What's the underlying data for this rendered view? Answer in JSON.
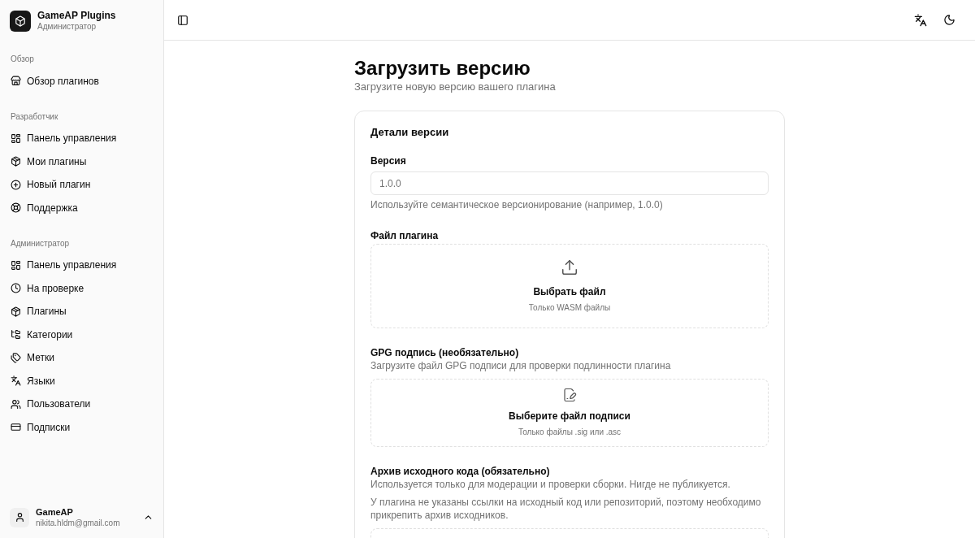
{
  "app": {
    "name": "GameAP Plugins",
    "role": "Администратор"
  },
  "sidebar": {
    "sections": [
      {
        "title": "Обзор",
        "items": [
          {
            "label": "Обзор плагинов",
            "kind": "store"
          }
        ]
      },
      {
        "title": "Разработчик",
        "items": [
          {
            "label": "Панель управления",
            "kind": "dashboard"
          },
          {
            "label": "Мои плагины",
            "kind": "package"
          },
          {
            "label": "Новый плагин",
            "kind": "add"
          },
          {
            "label": "Поддержка",
            "kind": "support"
          }
        ]
      },
      {
        "title": "Администратор",
        "items": [
          {
            "label": "Панель управления",
            "kind": "dashboard"
          },
          {
            "label": "На проверке",
            "kind": "review"
          },
          {
            "label": "Плагины",
            "kind": "package"
          },
          {
            "label": "Категории",
            "kind": "categories"
          },
          {
            "label": "Метки",
            "kind": "tags"
          },
          {
            "label": "Языки",
            "kind": "languages"
          },
          {
            "label": "Пользователи",
            "kind": "users"
          },
          {
            "label": "Подписки",
            "kind": "subscriptions"
          }
        ]
      }
    ]
  },
  "user": {
    "name": "GameAP",
    "email": "nikita.hldm@gmail.com"
  },
  "page": {
    "title": "Загрузить версию",
    "subtitle": "Загрузите новую версию вашего плагина"
  },
  "card": {
    "title": "Детали версии",
    "version_field": {
      "label": "Версия",
      "placeholder": "1.0.0",
      "hint": "Используйте семантическое версионирование (например, 1.0.0)"
    },
    "sections": [
      {
        "label": "Файл плагина",
        "dropzone": {
          "kind": "upload",
          "title": "Выбрать файл",
          "hint": "Только WASM файлы"
        }
      },
      {
        "label": "GPG подпись (необязательно)",
        "notes": [
          "Загрузите файл GPG подписи для проверки подлинности плагина"
        ],
        "dropzone": {
          "kind": "signature",
          "title": "Выберите файл подписи",
          "hint": "Только файлы .sig или .asc"
        }
      },
      {
        "label": "Архив исходного кода (обязательно)",
        "notes": [
          "Используется только для модерации и проверки сборки. Нигде не публикуется.",
          "У плагина не указаны ссылки на исходный код или репозиторий, поэтому необходимо прикрепить архив исходников."
        ],
        "dropzone": {
          "kind": "archive"
        }
      }
    ]
  }
}
